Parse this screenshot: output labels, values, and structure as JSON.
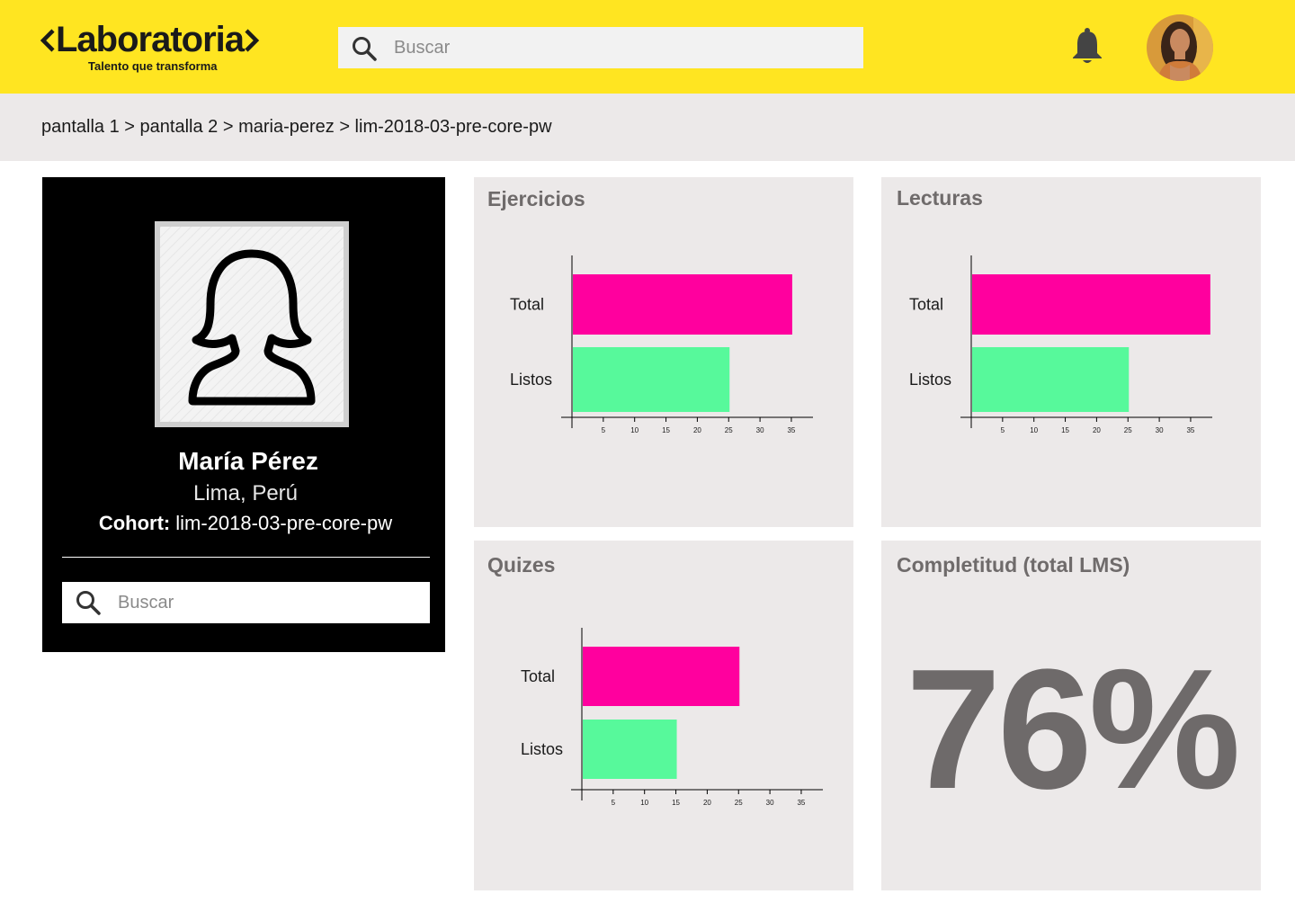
{
  "header": {
    "logo_text": "Laboratoria",
    "logo_tagline": "Talento que transforma",
    "search_placeholder": "Buscar"
  },
  "breadcrumb": "pantalla 1 > pantalla 2 > maria-perez > lim-2018-03-pre-core-pw",
  "profile": {
    "name": "María Pérez",
    "location": "Lima, Perú",
    "cohort_label": "Cohort:",
    "cohort_value": "lim-2018-03-pre-core-pw",
    "search_placeholder": "Buscar"
  },
  "colors": {
    "brand_yellow": "#FFE521",
    "total_bar": "#FF009E",
    "listos_bar": "#57F99B",
    "card_bg": "#ECE9E9"
  },
  "cards": {
    "ejercicios_title": "Ejercicios",
    "lecturas_title": "Lecturas",
    "quizes_title": "Quizes",
    "completitud_title": "Completitud (total LMS)",
    "completitud_value": "76%"
  },
  "chart_data": [
    {
      "type": "bar",
      "orientation": "horizontal",
      "title": "Ejercicios",
      "categories": [
        "Total",
        "Listos"
      ],
      "values": [
        35,
        25
      ],
      "xticks": [
        5,
        10,
        15,
        20,
        25,
        30,
        35
      ],
      "xlim": [
        0,
        38
      ]
    },
    {
      "type": "bar",
      "orientation": "horizontal",
      "title": "Lecturas",
      "categories": [
        "Total",
        "Listos"
      ],
      "values": [
        38,
        25
      ],
      "xticks": [
        5,
        10,
        15,
        20,
        25,
        30,
        35
      ],
      "xlim": [
        0,
        38
      ]
    },
    {
      "type": "bar",
      "orientation": "horizontal",
      "title": "Quizes",
      "categories": [
        "Total",
        "Listos"
      ],
      "values": [
        25,
        15
      ],
      "xticks": [
        5,
        10,
        15,
        20,
        25,
        30,
        35
      ],
      "xlim": [
        0,
        38
      ]
    }
  ]
}
